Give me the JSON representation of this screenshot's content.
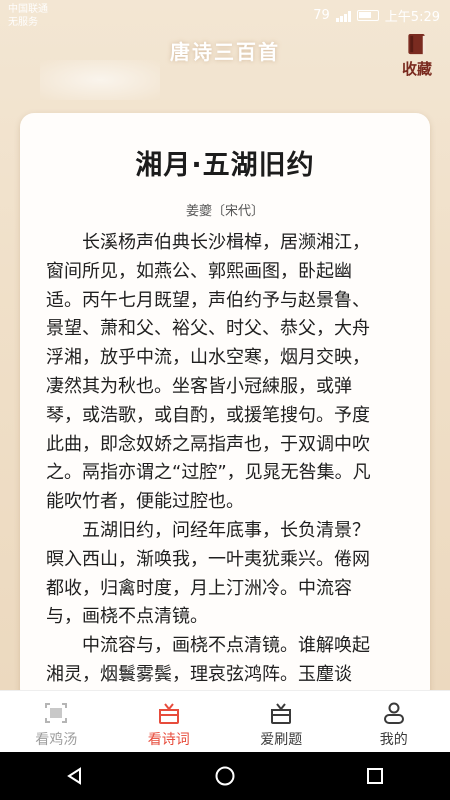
{
  "status_bar": {
    "carrier_line1": "中国联通",
    "carrier_line2": "无服务",
    "battery": "79",
    "time": "上午5:29"
  },
  "header": {
    "title": "唐诗三百首",
    "favorite_label": "收藏"
  },
  "poem": {
    "title": "湘月·五湖旧约",
    "author": "姜夔〔宋代〕",
    "paragraphs": [
      "长溪杨声伯典长沙楫棹，居濒湘江，窗间所见，如燕公、郭熙画图，卧起幽适。丙午七月既望，声伯约予与赵景鲁、景望、萧和父、裕父、时父、恭父，大舟浮湘，放乎中流，山水空寒，烟月交映，凄然其为秋也。坐客皆小冠綀服，或弹琴，或浩歌，或自酌，或援笔搜句。予度此曲，即念奴娇之鬲指声也，于双调中吹之。鬲指亦谓之“过腔”，见晁无咎集。凡能吹竹者，便能过腔也。",
      "五湖旧约，问经年底事，长负清景？暝入西山，渐唤我，一叶夷犹乘兴。倦网都收，归禽时度，月上汀洲冷。中流容与，画桡不点清镜。",
      "中流容与，画桡不点清镜。谁解唤起湘灵，烟鬟雾鬓，理哀弦鸿阵。玉麈谈玄，"
    ]
  },
  "nav": {
    "items": [
      {
        "label": "看鸡汤",
        "icon": "frame-icon"
      },
      {
        "label": "看诗词",
        "icon": "gift-box-icon"
      },
      {
        "label": "爱刷题",
        "icon": "gift-box-icon"
      },
      {
        "label": "我的",
        "icon": "user-icon"
      }
    ],
    "active_index": 1
  },
  "colors": {
    "accent": "#e74c3c",
    "favorite": "#7a2b20",
    "background": "#f1e3cf"
  }
}
